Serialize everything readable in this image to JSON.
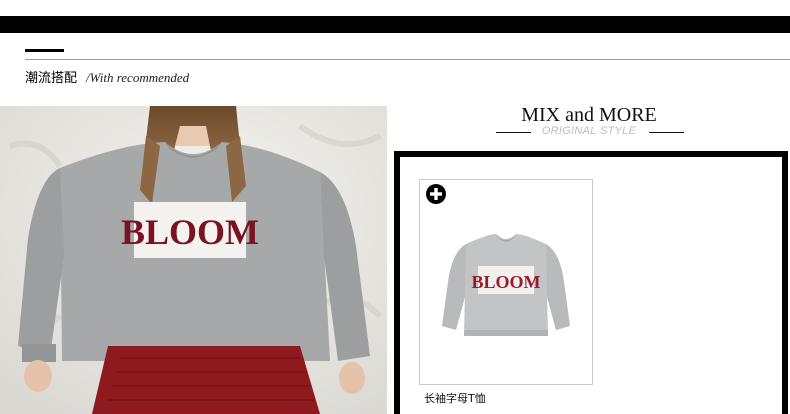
{
  "header": {
    "section_title_cn": "潮流搭配",
    "section_title_en": "/With recommended"
  },
  "mix": {
    "title": "MIX and MORE",
    "subtitle": "ORIGINAL STYLE"
  },
  "model_photo": {
    "print_text": "BLOOM"
  },
  "product": {
    "name": "长袖字母T恤",
    "print_text": "BLOOM",
    "add_icon": "plus-circle-icon"
  }
}
